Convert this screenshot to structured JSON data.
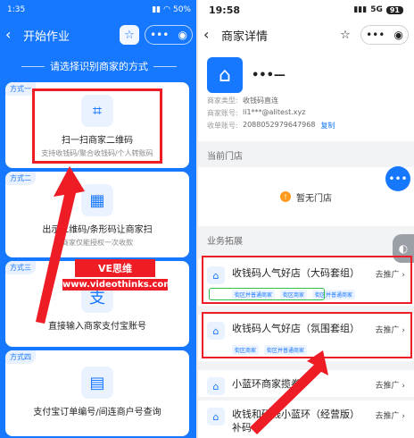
{
  "left": {
    "status_time": "1:35",
    "status_battery": "50%",
    "nav_title": "开始作业",
    "prompt": "请选择识别商家的方式",
    "methods": [
      {
        "tag": "方式一",
        "title": "扫一扫商家二维码",
        "sub": "支持收钱码/聚合收钱码/个人转账码",
        "icon": "scan-icon"
      },
      {
        "tag": "方式二",
        "title": "出示二维码/条形码让商家扫",
        "sub": "商家仅能授权一次收款",
        "icon": "qrcode-icon"
      },
      {
        "tag": "方式三",
        "title": "直接输入商家支付宝账号",
        "sub": "",
        "icon": "alipay-icon"
      },
      {
        "tag": "方式四",
        "title": "支付宝订单编号/间连商户号查询",
        "sub": "",
        "icon": "document-icon"
      }
    ],
    "watermark": {
      "brand": "VE思维",
      "url": "www.videothinks.com"
    }
  },
  "right": {
    "status_time": "19:58",
    "status_net": "5G",
    "status_battery": "91",
    "nav_title": "商家详情",
    "merchant": {
      "name": "•••—",
      "type_label": "商家类型:",
      "type_value": "收钱码直连",
      "account_label": "商家账号:",
      "account_value": "li1***@alitest.xyz",
      "pid_label": "收单账号:",
      "pid_value": "2088052979647968",
      "copy": "复制"
    },
    "current_store_title": "当前门店",
    "no_store": "暂无门店",
    "biz_title": "业务拓展",
    "biz_items": [
      {
        "name": "收钱码人气好店（大码套组）",
        "go": "去推广 ›",
        "tags": [
          "街区并普通商家",
          "街区商家",
          "街区并普通商家"
        ]
      },
      {
        "name": "收钱码人气好店（氛围套组）",
        "go": "去推广 ›",
        "tags": [
          "街区商家",
          "街区并普通商家"
        ]
      },
      {
        "name": "小蓝环商家揽券",
        "go": "去推广 ›",
        "tags": []
      },
      {
        "name": "收钱和码钱小蓝环（经营版）补码",
        "go": "去推广 ›",
        "tags": []
      }
    ]
  },
  "colors": {
    "accent": "#1677ff",
    "annotation_red": "#ee1c25",
    "annotation_green": "#2fbf4a"
  }
}
